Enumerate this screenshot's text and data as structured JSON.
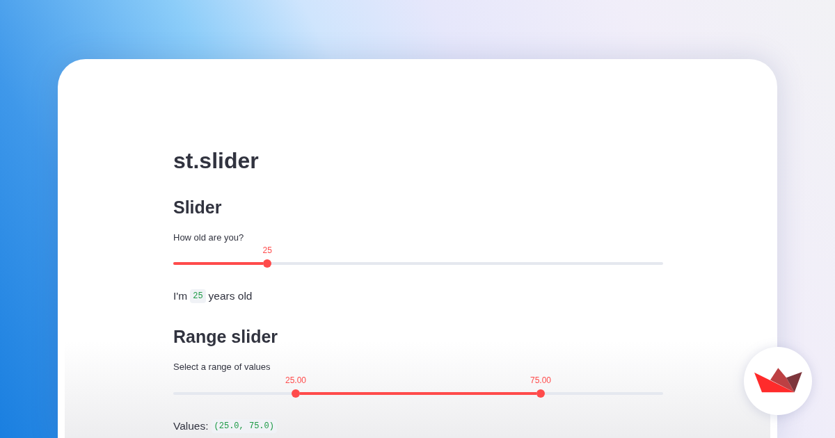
{
  "title": "st.slider",
  "sections": [
    {
      "heading": "Slider",
      "widget": {
        "kind": "single",
        "label": "How old are you?",
        "thumbs": [
          {
            "value": "25",
            "level": 0.192
          }
        ]
      },
      "output": [
        {
          "kind": "text",
          "text": "I'm"
        },
        {
          "kind": "code",
          "text": "25"
        },
        {
          "kind": "text",
          "text": "years old"
        }
      ]
    },
    {
      "heading": "Range slider",
      "widget": {
        "kind": "range",
        "label": "Select a range of values",
        "thumbs": [
          {
            "value": "25.00",
            "level": 0.25
          },
          {
            "value": "75.00",
            "level": 0.75
          }
        ]
      },
      "output": [
        {
          "kind": "text",
          "text": "Values:"
        },
        {
          "kind": "code",
          "text": "(25.0, 75.0)"
        }
      ]
    }
  ]
}
